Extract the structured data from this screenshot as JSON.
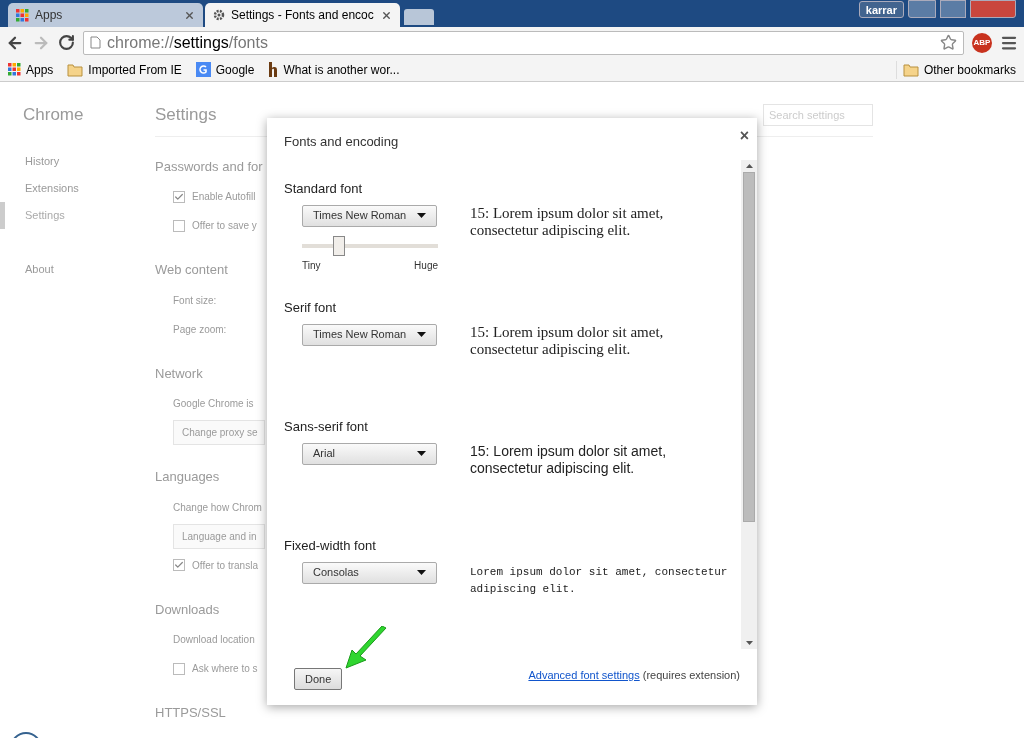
{
  "browser": {
    "tabs": [
      {
        "title": "Apps",
        "selected": false,
        "kind": "apps"
      },
      {
        "title": "Settings - Fonts and encoc",
        "selected": true,
        "kind": "settings"
      }
    ],
    "profile": "karrar",
    "address": {
      "scheme": "chrome://",
      "host": "settings",
      "path": "/fonts"
    },
    "extension": "ABP",
    "bookmarks": [
      {
        "label": "Apps",
        "kind": "apps"
      },
      {
        "label": "Imported From IE",
        "kind": "folder"
      },
      {
        "label": "Google",
        "kind": "google"
      },
      {
        "label": "What is another wor...",
        "kind": "h"
      }
    ],
    "other_bookmarks": "Other bookmarks"
  },
  "sidebar": {
    "title": "Chrome",
    "items": [
      {
        "label": "History",
        "selected": false
      },
      {
        "label": "Extensions",
        "selected": false
      },
      {
        "label": "Settings",
        "selected": true
      },
      {
        "label": "About",
        "selected": false
      }
    ]
  },
  "settings": {
    "title": "Settings",
    "search": {
      "placeholder": "Search settings"
    },
    "sections": [
      {
        "heading": "Passwords and for",
        "rows": [
          {
            "kind": "checkbox",
            "label": "Enable Autofill",
            "checked": true
          },
          {
            "kind": "checkbox",
            "label": "Offer to save y",
            "checked": false
          }
        ]
      },
      {
        "heading": "Web content",
        "rows": [
          {
            "kind": "text",
            "label": "Font size:"
          },
          {
            "kind": "text",
            "label": "Page zoom:"
          }
        ]
      },
      {
        "heading": "Network",
        "rows": [
          {
            "kind": "text",
            "label": "Google Chrome is"
          },
          {
            "kind": "button",
            "label": "Change proxy se"
          }
        ]
      },
      {
        "heading": "Languages",
        "rows": [
          {
            "kind": "text",
            "label": "Change how Chrom"
          },
          {
            "kind": "button",
            "label": "Language and in"
          },
          {
            "kind": "checkbox",
            "label": "Offer to transla",
            "checked": true
          }
        ]
      },
      {
        "heading": "Downloads",
        "rows": [
          {
            "kind": "text",
            "label": "Download location"
          },
          {
            "kind": "checkbox",
            "label": "Ask where to s",
            "checked": false
          }
        ]
      },
      {
        "heading": "HTTPS/SSL"
      }
    ]
  },
  "dialog": {
    "title": "Fonts and encoding",
    "close": "×",
    "fonts": [
      {
        "label": "Standard font",
        "font": "Times New Roman",
        "kind": "serif",
        "sample": "15: Lorem ipsum dolor sit amet, consectetur adipiscing elit.",
        "slider": {
          "level": 0.27,
          "min_label": "Tiny",
          "max_label": "Huge"
        }
      },
      {
        "label": "Serif font",
        "font": "Times New Roman",
        "kind": "serif",
        "sample": "15: Lorem ipsum dolor sit amet, consectetur adipiscing elit."
      },
      {
        "label": "Sans-serif font",
        "font": "Arial",
        "kind": "sans",
        "sample": "15: Lorem ipsum dolor sit amet, consectetur adipiscing elit."
      },
      {
        "label": "Fixed-width font",
        "font": "Consolas",
        "kind": "mono",
        "sample": "Lorem ipsum dolor sit amet, consectetur adipiscing elit."
      }
    ],
    "done": "Done",
    "link": "Advanced font settings",
    "note": "(requires extension)"
  }
}
